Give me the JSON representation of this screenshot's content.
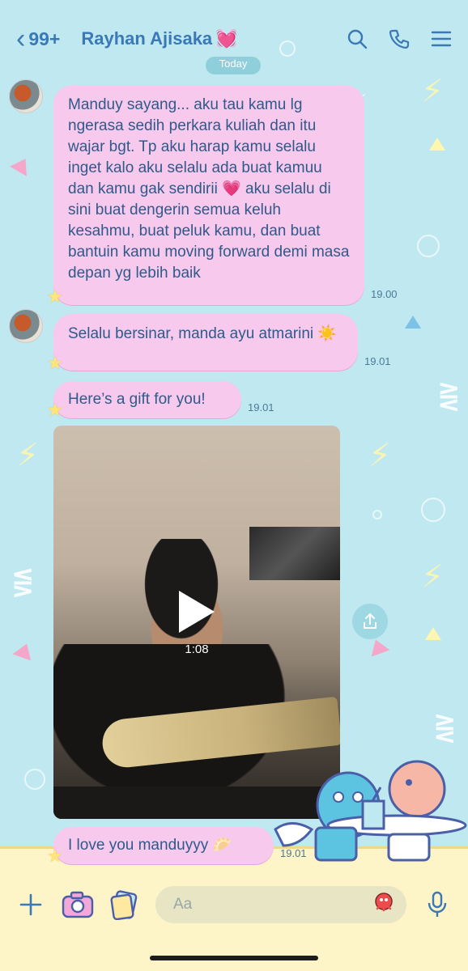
{
  "header": {
    "back_count": "99+",
    "contact_name": "Rayhan Ajisaka",
    "contact_emoji": "💓"
  },
  "date_separator": "Today",
  "messages": [
    {
      "text": "Manduy sayang... aku tau kamu lg ngerasa sedih perkara kuliah dan itu wajar bgt. Tp aku harap kamu selalu inget kalo aku selalu ada buat kamuu dan kamu gak sendirii 💗 aku selalu di sini buat dengerin semua keluh kesahmu, buat peluk kamu, dan buat bantuin kamu moving forward demi masa depan yg lebih baik",
      "time": "19.00"
    },
    {
      "text": "Selalu bersinar, manda ayu atmarini ☀️",
      "time": "19.01"
    },
    {
      "text": "Here’s a gift for you!",
      "time": "19.01"
    },
    {
      "text": "I love you manduyyy 🥟",
      "time": "19.01"
    }
  ],
  "video": {
    "duration": "1:08"
  },
  "composer": {
    "placeholder": "Aa"
  },
  "colors": {
    "background": "#bfe8f0",
    "bubble": "#f7c9ec",
    "accent_blue": "#3a79b5",
    "bottom_bar": "#fdf4c8"
  }
}
